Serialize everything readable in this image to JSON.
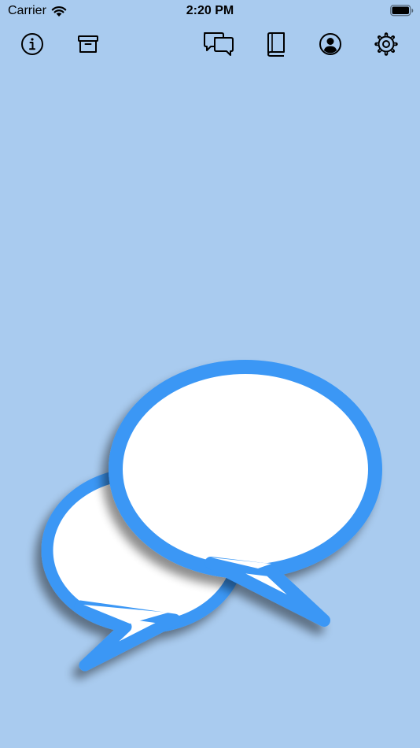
{
  "status_bar": {
    "carrier": "Carrier",
    "time": "2:20 PM"
  },
  "toolbar": {
    "icons": [
      "info-icon",
      "archive-icon",
      "chat-bubbles-icon",
      "book-icon",
      "person-icon",
      "gear-icon"
    ]
  },
  "colors": {
    "background": "#a9cbef",
    "bubble_outline": "#3a97f5",
    "bubble_fill": "#ffffff"
  }
}
